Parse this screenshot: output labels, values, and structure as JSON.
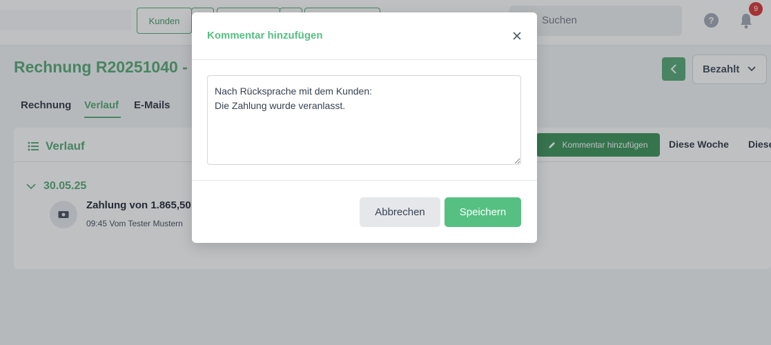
{
  "topbar": {
    "nav_first_label": "Kunden",
    "search_placeholder": "Suchen",
    "help_glyph": "?",
    "notifications_count": "9"
  },
  "page": {
    "title": "Rechnung R20251040 -",
    "status_value": "Bezahlt",
    "tabs": [
      {
        "label": "Rechnung"
      },
      {
        "label": "Verlauf"
      },
      {
        "label": "E-Mails"
      }
    ]
  },
  "history": {
    "title": "Verlauf",
    "add_comment_label": "Kommentar hinzufügen",
    "filter_this_week": "Diese Woche",
    "filter_next": "Diese",
    "date": "30.05.25",
    "entry_title": "Zahlung von 1.865,50",
    "entry_meta": "09:45 Vom Tester Mustern"
  },
  "modal": {
    "title": "Kommentar hinzufügen",
    "comment_text": "Nach Rücksprache mit dem Kunden:\nDie Zahlung wurde veranlasst.",
    "cancel_label": "Abbrechen",
    "save_label": "Speichern"
  },
  "colors": {
    "accent_green": "#55c082",
    "dark_green": "#4aa36b",
    "badge_red": "#dc2626"
  }
}
